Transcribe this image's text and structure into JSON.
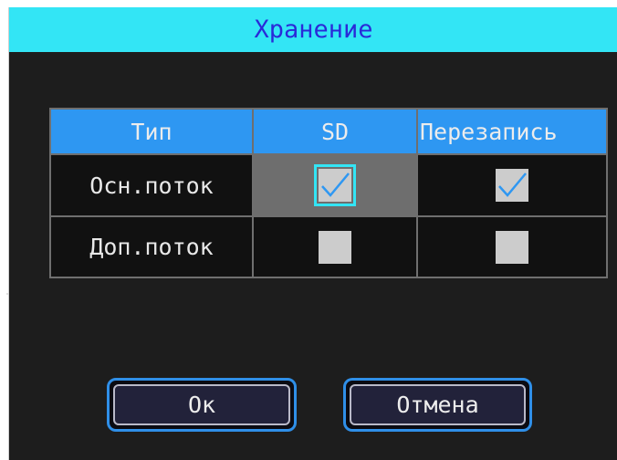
{
  "dialog": {
    "title": "Хранение"
  },
  "table": {
    "headers": [
      "Тип",
      "SD",
      "Перезапись"
    ],
    "rows": [
      {
        "label": "Осн.поток",
        "sd": true,
        "overwrite": true
      },
      {
        "label": "Доп.поток",
        "sd": false,
        "overwrite": false
      }
    ]
  },
  "buttons": {
    "ok_label": "Ок",
    "cancel_label": "Отмена"
  },
  "colors": {
    "title_bar": "#33e5f5",
    "title_text": "#2a2ad8",
    "table_header": "#2e97f2",
    "checkbox": "#cccccc",
    "checkmark": "#2e97f2",
    "focus": "#33e5f5",
    "button_border": "#2f8fe8"
  }
}
